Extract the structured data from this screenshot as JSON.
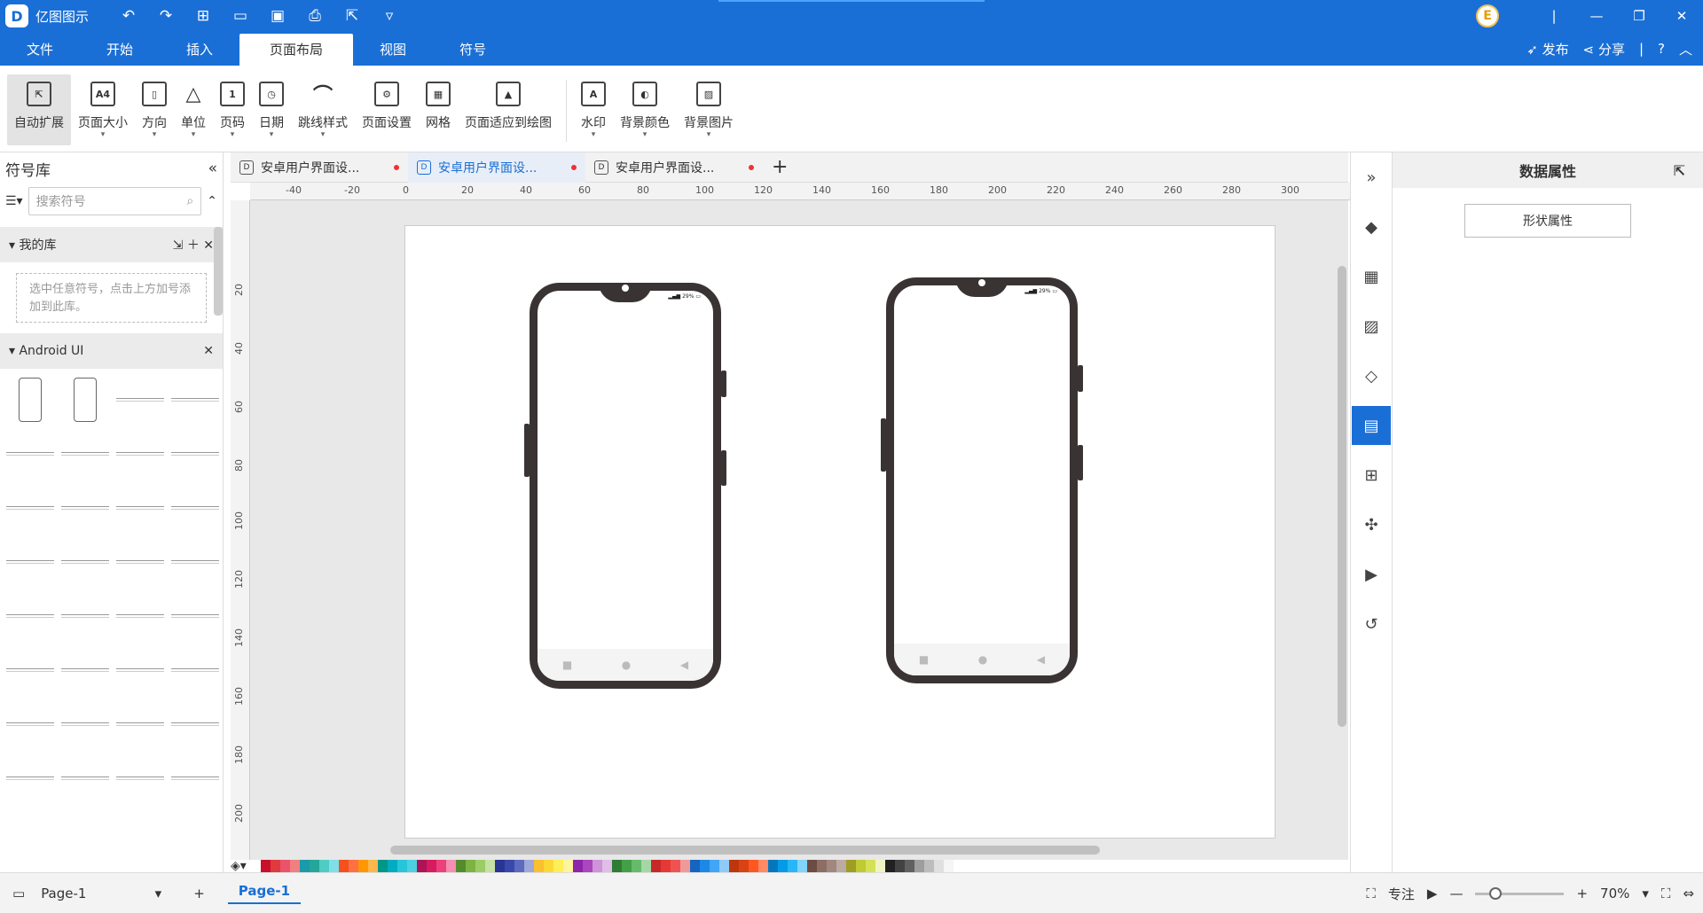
{
  "app": {
    "name": "亿图图示"
  },
  "menu_tabs": [
    "文件",
    "开始",
    "插入",
    "页面布局",
    "视图",
    "符号"
  ],
  "menu_right": {
    "publish": "发布",
    "share": "分享"
  },
  "ribbon": [
    {
      "label": "自动扩展",
      "icon": "auto-expand-icon"
    },
    {
      "label": "页面大小",
      "icon": "page-size-icon"
    },
    {
      "label": "方向",
      "icon": "orientation-icon"
    },
    {
      "label": "单位",
      "icon": "unit-icon"
    },
    {
      "label": "页码",
      "icon": "page-number-icon"
    },
    {
      "label": "日期",
      "icon": "date-icon"
    },
    {
      "label": "跳线样式",
      "icon": "jump-line-icon"
    },
    {
      "label": "页面设置",
      "icon": "page-setup-icon"
    },
    {
      "label": "网格",
      "icon": "grid-icon"
    },
    {
      "label": "页面适应到绘图",
      "icon": "fit-to-drawing-icon"
    },
    {
      "label": "水印",
      "icon": "watermark-icon"
    },
    {
      "label": "背景颜色",
      "icon": "background-color-icon"
    },
    {
      "label": "背景图片",
      "icon": "background-image-icon"
    }
  ],
  "symbol_library": {
    "title": "符号库",
    "search_placeholder": "搜索符号",
    "my_library": "我的库",
    "my_library_hint": "选中任意符号，点击上方加号添加到此库。",
    "android_ui": "Android UI"
  },
  "doc_tabs": [
    {
      "label": "安卓用户界面设..."
    },
    {
      "label": "安卓用户界面设..."
    },
    {
      "label": "安卓用户界面设..."
    }
  ],
  "ruler_h": [
    "-40",
    "-20",
    "0",
    "20",
    "40",
    "60",
    "80",
    "100",
    "120",
    "140",
    "160",
    "180",
    "200",
    "220",
    "240",
    "260",
    "280",
    "300"
  ],
  "ruler_v": [
    "20",
    "40",
    "60",
    "80",
    "100",
    "120",
    "140",
    "160",
    "180",
    "200"
  ],
  "device_status": "29%",
  "palette_colors": [
    "#c8102e",
    "#e03a3e",
    "#e9546b",
    "#f08080",
    "#1b9aaa",
    "#26a69a",
    "#4ecdc4",
    "#80deea",
    "#f4511e",
    "#ff7043",
    "#ff9800",
    "#ffb74d",
    "#009688",
    "#00acc1",
    "#26c6da",
    "#4dd0e1",
    "#ad1457",
    "#d81b60",
    "#ec407a",
    "#f48fb1",
    "#558b2f",
    "#7cb342",
    "#9ccc65",
    "#c5e1a5",
    "#283593",
    "#3949ab",
    "#5c6bc0",
    "#9fa8da",
    "#fbc02d",
    "#fdd835",
    "#ffee58",
    "#fff59d",
    "#8e24aa",
    "#ab47bc",
    "#ce93d8",
    "#e1bee7",
    "#2e7d32",
    "#43a047",
    "#66bb6a",
    "#a5d6a7",
    "#c62828",
    "#e53935",
    "#ef5350",
    "#ef9a9a",
    "#1565c0",
    "#1e88e5",
    "#42a5f5",
    "#90caf9",
    "#bf360c",
    "#d84315",
    "#ff5722",
    "#ff8a65",
    "#0277bd",
    "#039be5",
    "#29b6f6",
    "#81d4fa",
    "#6d4c41",
    "#8d6e63",
    "#a1887f",
    "#bcaaa4",
    "#9e9d24",
    "#c0ca33",
    "#d4e157",
    "#f0f4c3",
    "#212121",
    "#424242",
    "#616161",
    "#9e9e9e",
    "#bdbdbd",
    "#e0e0e0",
    "#f5f5f5"
  ],
  "right_tools": [
    "fill-icon",
    "layout-icon",
    "image-icon",
    "layers-icon",
    "data-icon",
    "shapes-icon",
    "connector-icon",
    "presentation-icon",
    "history-icon"
  ],
  "right_panel": {
    "title": "数据属性",
    "button": "形状属性"
  },
  "status": {
    "page_selector": "Page-1",
    "page_tab": "Page-1",
    "focus": "专注",
    "zoom": "70%"
  }
}
